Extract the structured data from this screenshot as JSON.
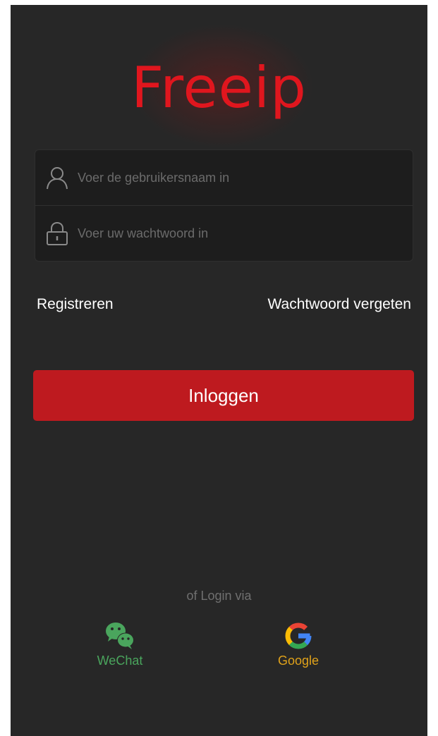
{
  "app": {
    "logo_text": "Freeip"
  },
  "form": {
    "username_placeholder": "Voer de gebruikersnaam in",
    "password_placeholder": "Voer uw wachtwoord in",
    "username_icon": "user-icon",
    "password_icon": "lock-icon"
  },
  "links": {
    "register": "Registreren",
    "forgot_password": "Wachtwoord vergeten"
  },
  "login_button": "Inloggen",
  "alt_login": {
    "label": "of Login via",
    "providers": [
      {
        "label": "WeChat",
        "icon": "wechat-icon",
        "color": "#4aa55d"
      },
      {
        "label": "Google",
        "icon": "google-icon",
        "color": "#e0a21a"
      }
    ]
  },
  "colors": {
    "background": "#272727",
    "accent": "#be1a1f",
    "logo": "#e0161e"
  }
}
